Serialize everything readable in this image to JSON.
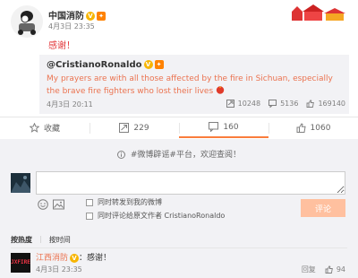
{
  "post": {
    "author": "中国消防",
    "time": "4月3日 23:35",
    "text": "感谢！"
  },
  "quote": {
    "author": "@CristianoRonaldo",
    "text": "My prayers are with all those affected by the fire in Sichuan, especially the brave fire fighters who lost their lives",
    "time": "4月3日 20:11",
    "reposts": "10248",
    "comments": "5136",
    "likes": "169140"
  },
  "actions": {
    "favorite": "收藏",
    "repost": "229",
    "comment": "160",
    "like": "1060"
  },
  "comment_area": {
    "notice": "#微博辟谣#平台，欢迎查阅！",
    "input_value": "",
    "option_repost": "同时转发到我的微博",
    "option_comment_original": "同时评论给原文作者 CristianoRonaldo",
    "submit": "评论",
    "sort_hot": "按热度",
    "sort_time": "按时间",
    "sort_sep": "|"
  },
  "reply": {
    "avatar_text": "JXFIRE",
    "author": "江西消防",
    "separator": "：",
    "text": "感谢！",
    "time": "4月3日 23:35",
    "reply_label": "回复",
    "likes": "94"
  },
  "colors": {
    "accent": "#fa7d3c",
    "link": "#eb7350",
    "red_text": "#e3393c"
  }
}
